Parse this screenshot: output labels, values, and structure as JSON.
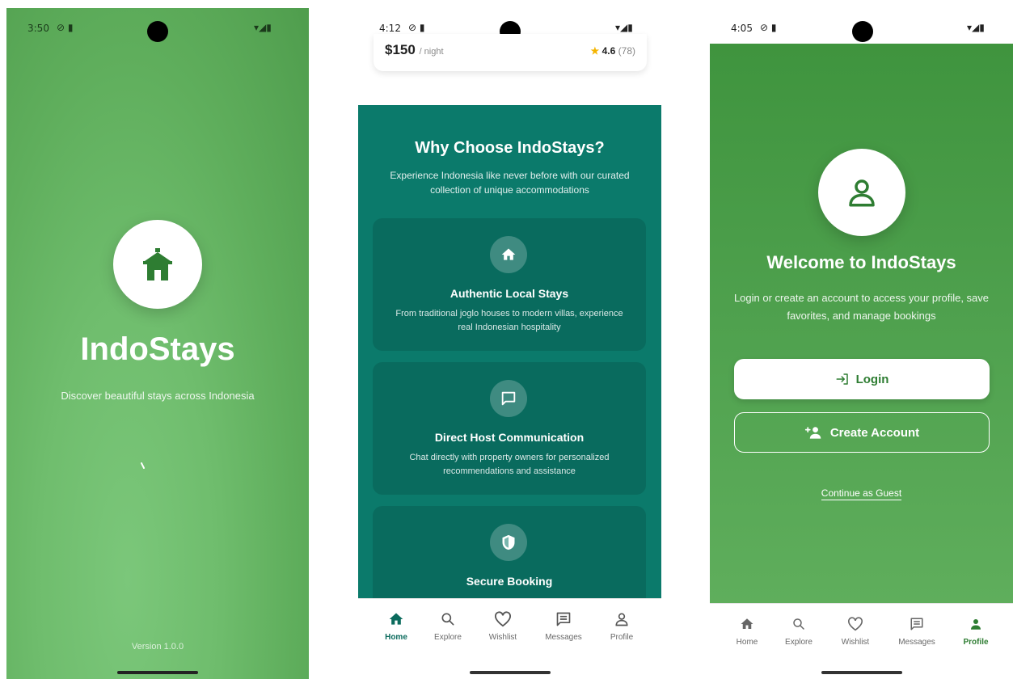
{
  "splash": {
    "status_time": "3:50",
    "app_name": "IndoStays",
    "tagline": "Discover beautiful stays across Indonesia",
    "version": "Version 1.0.0"
  },
  "home": {
    "status_time": "4:12",
    "listing": {
      "price": "$150",
      "price_unit": "/ night",
      "rating": "4.6",
      "rating_count": "(78)"
    },
    "why": {
      "title": "Why Choose IndoStays?",
      "subtitle": "Experience Indonesia like never before with our curated collection of unique accommodations",
      "features": [
        {
          "icon": "home-icon",
          "title": "Authentic Local Stays",
          "description": "From traditional joglo houses to modern villas, experience real Indonesian hospitality"
        },
        {
          "icon": "chat-icon",
          "title": "Direct Host Communication",
          "description": "Chat directly with property owners for personalized recommendations and assistance"
        },
        {
          "icon": "shield-icon",
          "title": "Secure Booking",
          "description": ""
        }
      ]
    },
    "nav": [
      {
        "label": "Home",
        "icon": "home-icon",
        "active": true
      },
      {
        "label": "Explore",
        "icon": "search-icon",
        "active": false
      },
      {
        "label": "Wishlist",
        "icon": "heart-icon",
        "active": false
      },
      {
        "label": "Messages",
        "icon": "messages-icon",
        "active": false
      },
      {
        "label": "Profile",
        "icon": "person-icon",
        "active": false
      }
    ]
  },
  "profile": {
    "status_time": "4:05",
    "title": "Welcome to IndoStays",
    "subtitle": "Login or create an account to access your profile, save favorites, and manage bookings",
    "login_label": "Login",
    "create_label": "Create Account",
    "guest_label": "Continue as Guest",
    "nav": [
      {
        "label": "Home",
        "icon": "home-icon",
        "active": false
      },
      {
        "label": "Explore",
        "icon": "search-icon",
        "active": false
      },
      {
        "label": "Wishlist",
        "icon": "heart-icon",
        "active": false
      },
      {
        "label": "Messages",
        "icon": "messages-icon",
        "active": false
      },
      {
        "label": "Profile",
        "icon": "person-icon",
        "active": true
      }
    ]
  },
  "colors": {
    "splash_green": "#5fae5c",
    "teal": "#0b7a6b",
    "teal_card": "#096b5e",
    "profile_green": "#4fa14e",
    "nav_active_teal": "#0b6b5d",
    "nav_active_green": "#2e7d32"
  }
}
